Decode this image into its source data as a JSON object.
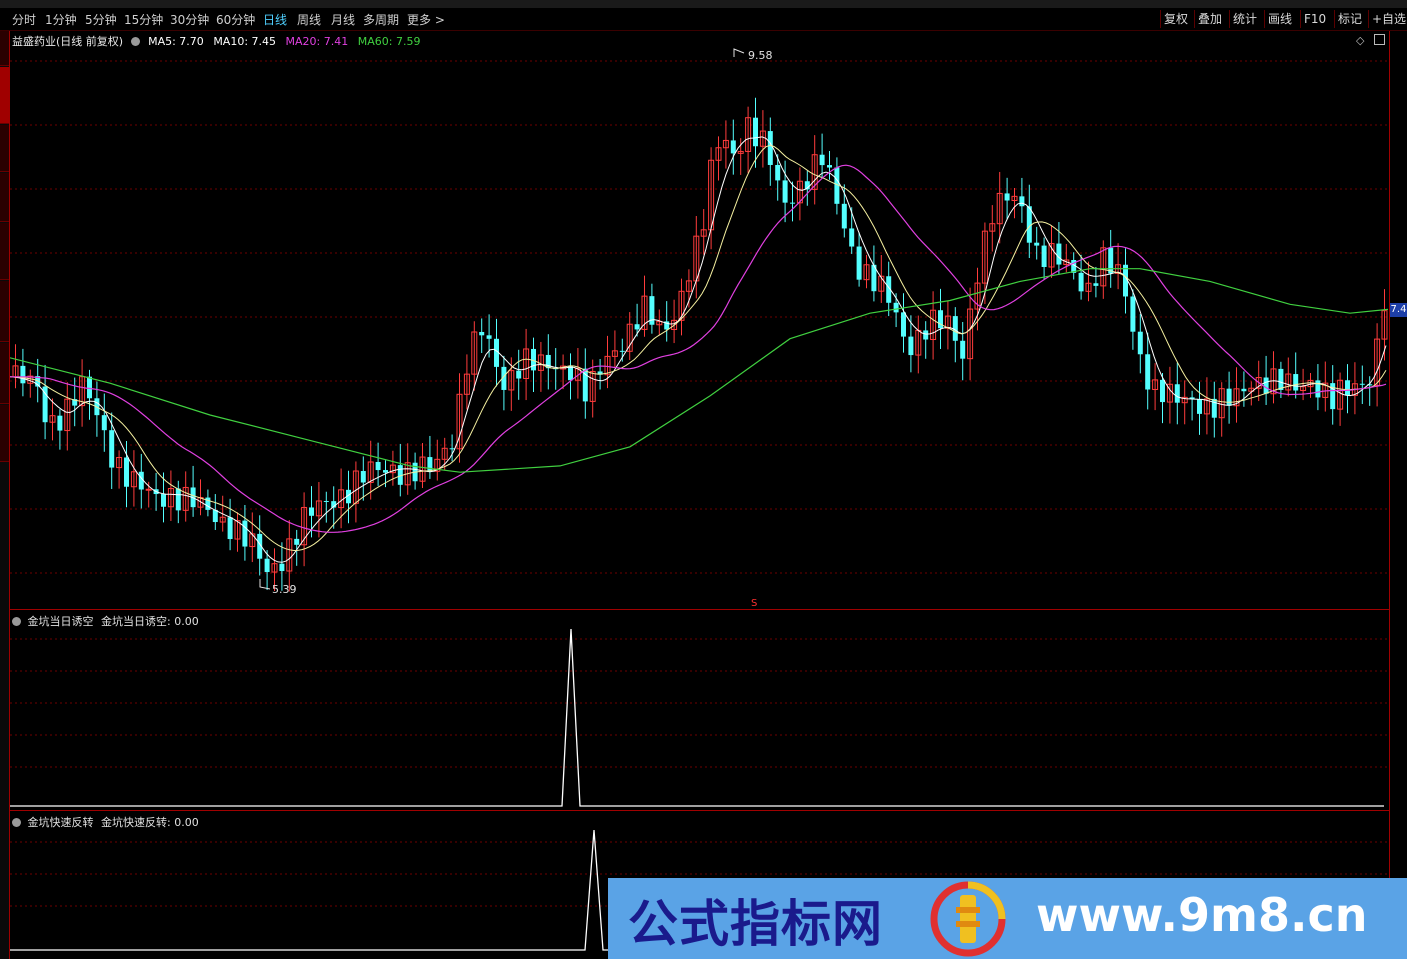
{
  "toolbar": {
    "periods": [
      "分时",
      "1分钟",
      "5分钟",
      "15分钟",
      "30分钟",
      "60分钟",
      "日线",
      "周线",
      "月线",
      "多周期",
      "更多 >"
    ],
    "active_period": "日线",
    "buttons": [
      "复权",
      "叠加",
      "统计",
      "画线",
      "F10",
      "标记",
      "+自选"
    ]
  },
  "main_panel": {
    "stock_title": "益盛药业(日线 前复权)",
    "ma_labels": [
      {
        "text": "MA5: 7.70",
        "color": "#ffffff"
      },
      {
        "text": "MA10: 7.45",
        "color": "#ffffff"
      },
      {
        "text": "MA20: 7.41",
        "color": "#e040e0"
      },
      {
        "text": "MA60: 7.59",
        "color": "#40d040"
      }
    ],
    "high_label": "9.58",
    "low_label": "5.39",
    "current_price_tag": "7.4",
    "signal_marker": "S"
  },
  "indicator1": {
    "title": "金坑当日诱空",
    "value_label": "金坑当日诱空: 0.00"
  },
  "indicator2": {
    "title": "金坑快速反转",
    "value_label": "金坑快速反转: 0.00"
  },
  "watermark": {
    "title": "公式指标网",
    "url": "www.9m8.cn"
  },
  "colors": {
    "up": "#ff3c3c",
    "down": "#54ffff",
    "ma5": "#ffffff",
    "ma10": "#f5f0a0",
    "ma20": "#e040e0",
    "ma60": "#40d040",
    "grid": "#6e0000"
  }
}
